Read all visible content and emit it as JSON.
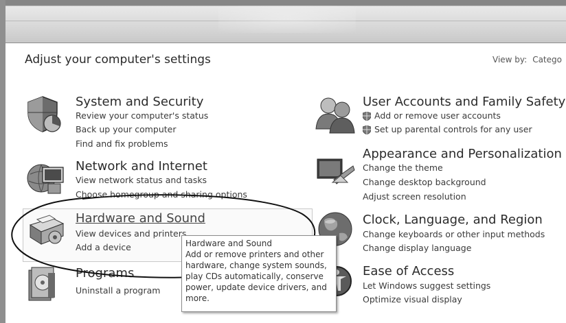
{
  "page": {
    "heading": "Adjust your computer's settings"
  },
  "view_by": {
    "label": "View by:",
    "value": "Catego"
  },
  "categories": [
    {
      "title": "System and Security",
      "links": [
        "Review your computer's status",
        "Back up your computer",
        "Find and fix problems"
      ]
    },
    {
      "title": "Network and Internet",
      "links": [
        "View network status and tasks",
        "Choose homegroup and sharing options"
      ]
    },
    {
      "title": "Hardware and Sound",
      "links": [
        "View devices and printers",
        "Add a device"
      ]
    },
    {
      "title": "Programs",
      "links": [
        "Uninstall a program"
      ]
    },
    {
      "title": "User Accounts and Family Safety",
      "links": [
        "Add or remove user accounts",
        "Set up parental controls for any user"
      ]
    },
    {
      "title": "Appearance and Personalization",
      "links": [
        "Change the theme",
        "Change desktop background",
        "Adjust screen resolution"
      ]
    },
    {
      "title": "Clock, Language, and Region",
      "links": [
        "Change keyboards or other input methods",
        "Change display language"
      ]
    },
    {
      "title": "Ease of Access",
      "links": [
        "Let Windows suggest settings",
        "Optimize visual display"
      ]
    }
  ],
  "tooltip": {
    "title": "Hardware and Sound",
    "body": "Add or remove printers and other hardware, change system sounds, play CDs automatically, conserve power, update device drivers, and more."
  },
  "icons": {
    "system_security": "shield-icon",
    "network": "network-icon",
    "hardware": "printer-icon",
    "programs": "programs-icon",
    "user_accounts": "users-icon",
    "appearance": "appearance-icon",
    "clock_region": "globe-icon",
    "ease_access": "ease-of-access-icon",
    "link_shield": "uac-shield-icon"
  }
}
